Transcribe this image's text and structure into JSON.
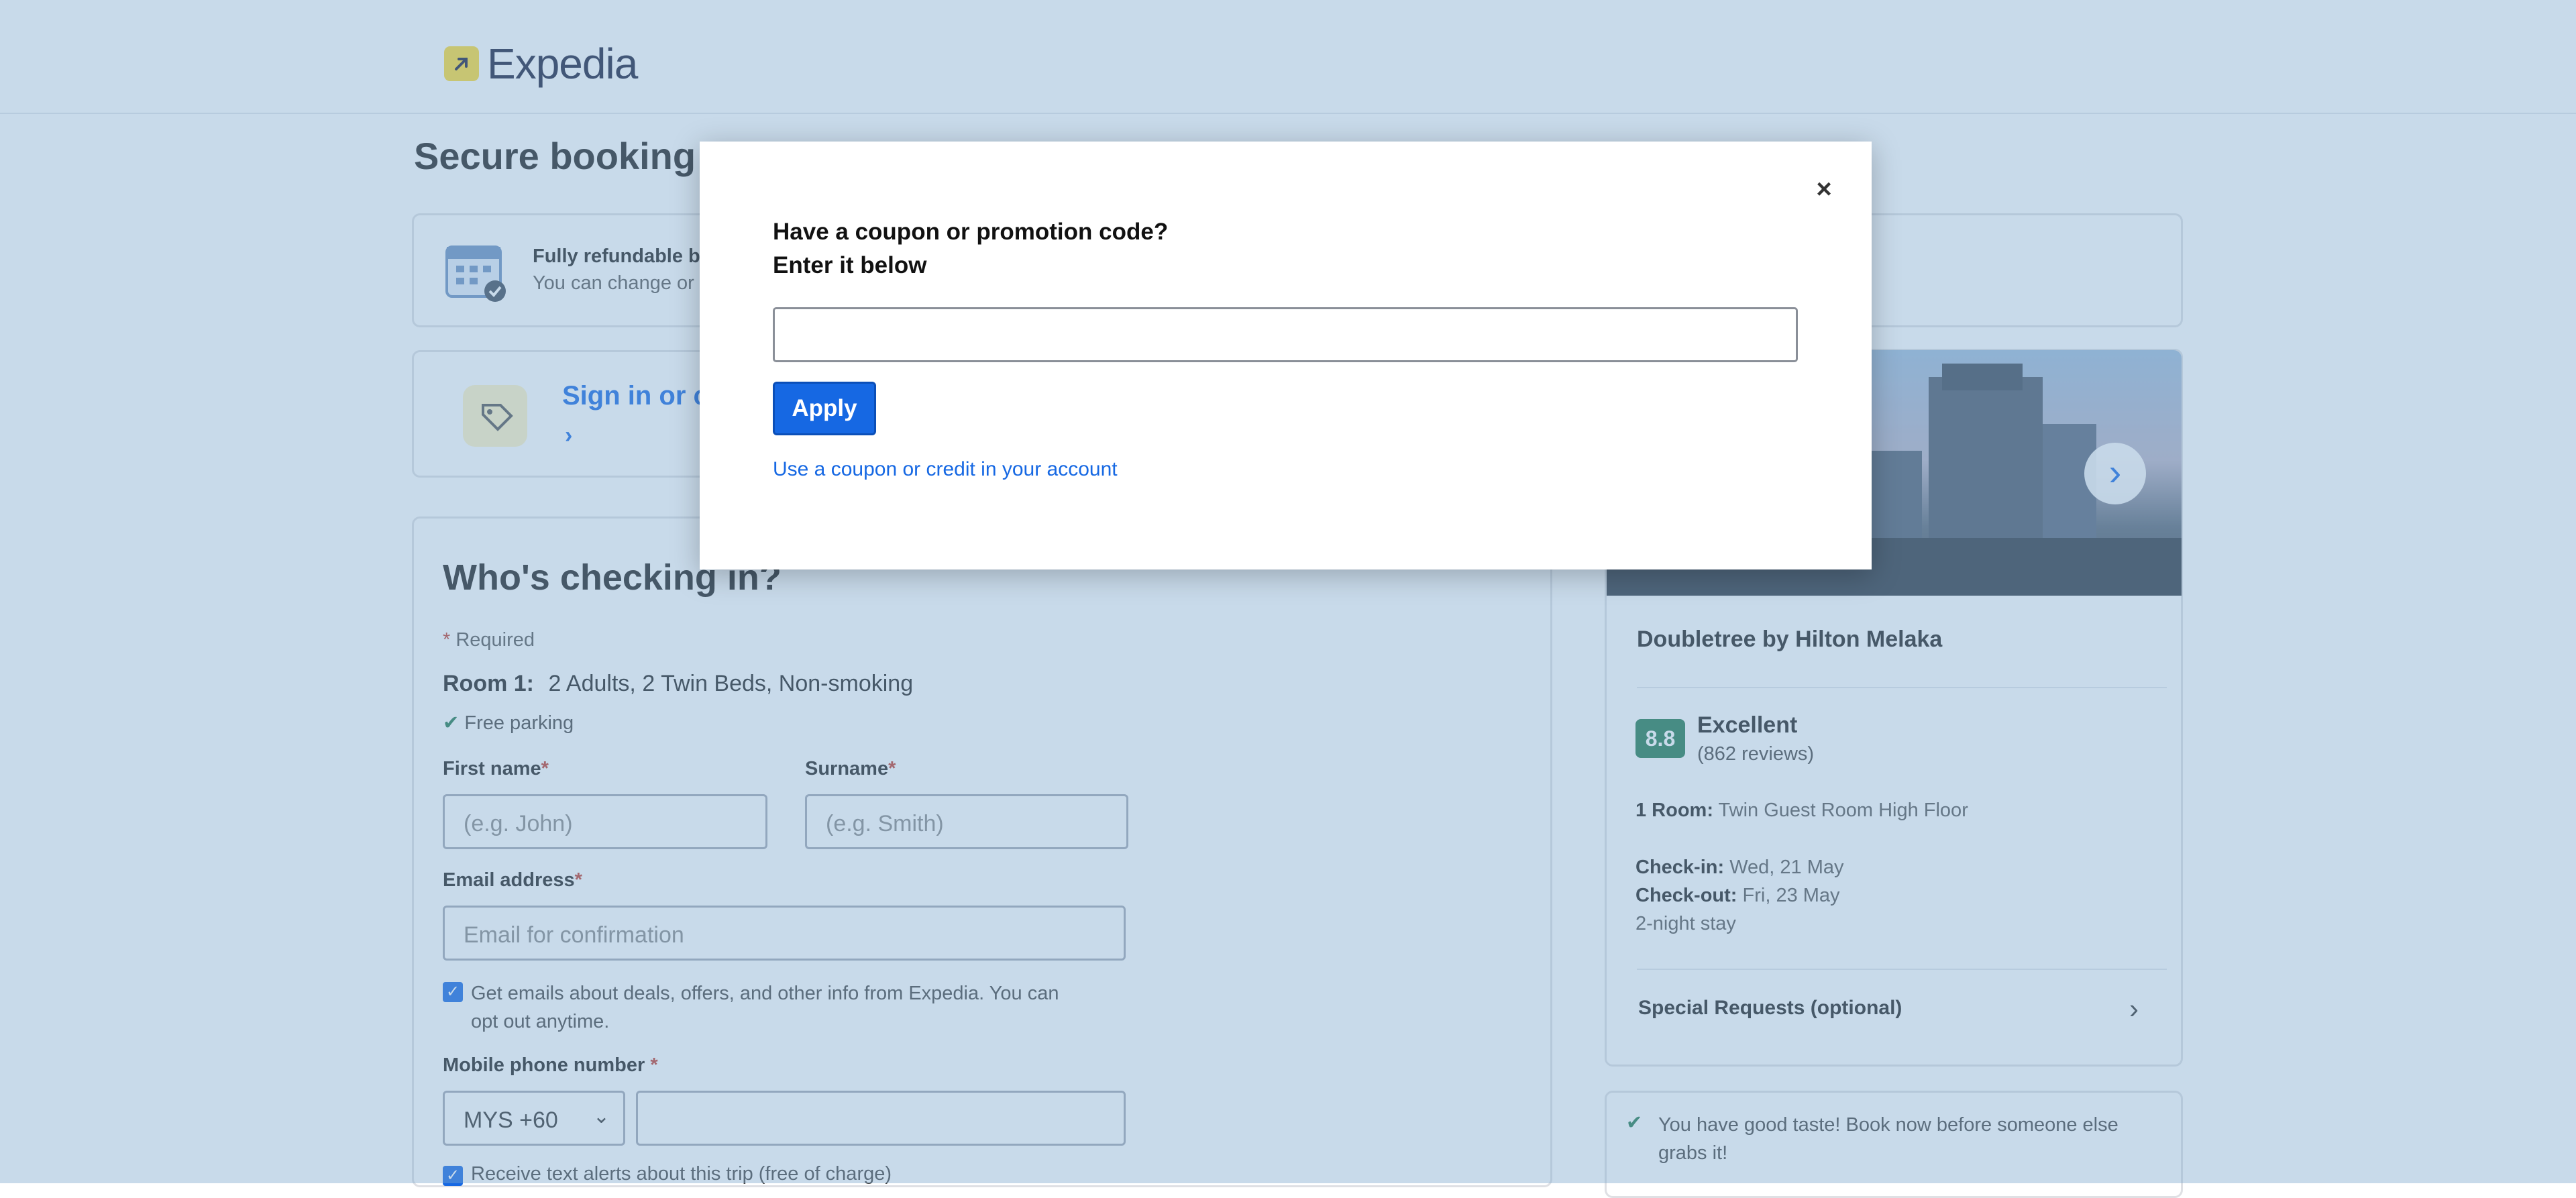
{
  "header": {
    "logo_text": "Expedia"
  },
  "page": {
    "title": "Secure booking",
    "notice": {
      "title": "Fully refundable b",
      "subtitle": "You can change or"
    },
    "signin": {
      "label": "Sign in or c"
    }
  },
  "form": {
    "heading": "Who's checking in?",
    "required_note": "Required",
    "room_label": "Room 1:",
    "room_value": "2 Adults, 2 Twin Beds, Non-smoking",
    "free_parking": "Free parking",
    "first_name_label": "First name",
    "first_name_placeholder": "(e.g. John)",
    "surname_label": "Surname",
    "surname_placeholder": "(e.g. Smith)",
    "email_label": "Email address",
    "email_placeholder": "Email for confirmation",
    "email_opt_in_line1": "Get emails about deals, offers, and other info from Expedia. You can",
    "email_opt_in_line2": "opt out anytime.",
    "phone_label": "Mobile phone number",
    "country_code": "MYS +60",
    "text_alerts": "Receive text alerts about this trip (free of charge)"
  },
  "summary": {
    "hotel_name": "Doubletree by Hilton Melaka",
    "rating_score": "8.8",
    "rating_label": "Excellent",
    "review_count": "(862 reviews)",
    "room_label": "1 Room:",
    "room_value": "Twin Guest Room High Floor",
    "checkin_label": "Check-in:",
    "checkin_value": "Wed, 21 May",
    "checkout_label": "Check-out:",
    "checkout_value": "Fri, 23 May",
    "stay_length": "2-night stay",
    "special_requests": "Special Requests (optional)",
    "taste_line1": "You have good taste! Book now before someone else",
    "taste_line2": "grabs it!"
  },
  "modal": {
    "title_line1": "Have a coupon or promotion code?",
    "title_line2": "Enter it below",
    "close_symbol": "×",
    "input_value": "",
    "apply_label": "Apply",
    "account_link": "Use a coupon or credit in your account"
  },
  "colors": {
    "overlay": "#7ca7ce",
    "primary_blue": "#1668e3",
    "rating_green": "#227950",
    "logo_yellow": "#fddb32"
  }
}
